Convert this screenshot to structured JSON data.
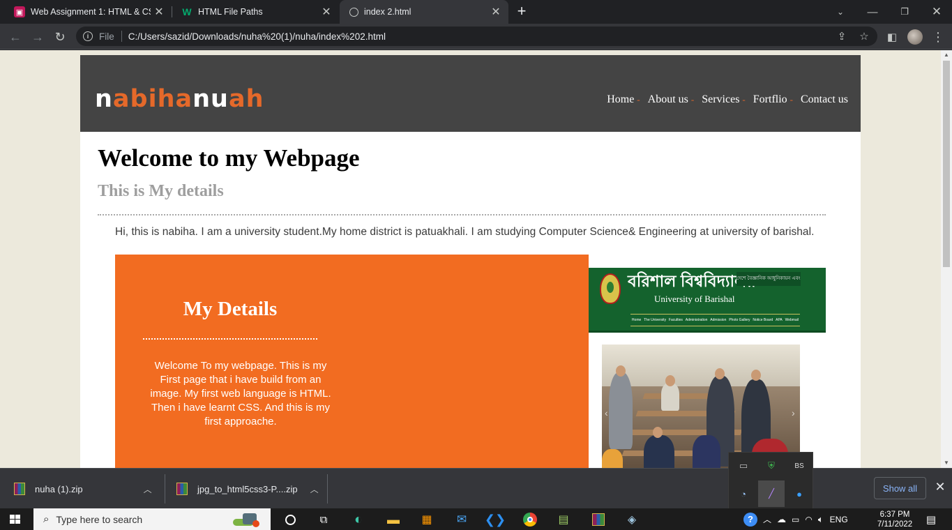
{
  "browser": {
    "tabs": [
      {
        "title": "Web Assignment 1: HTML & CSS",
        "active": false,
        "favicon": "google-classroom-icon"
      },
      {
        "title": "HTML File Paths",
        "active": false,
        "favicon": "w3schools-icon"
      },
      {
        "title": "index 2.html",
        "active": true,
        "favicon": "globe-icon"
      }
    ],
    "omnibox": {
      "scheme_label": "File",
      "url": "C:/Users/sazid/Downloads/nuha%20(1)/nuha/index%202.html"
    }
  },
  "site": {
    "logo": [
      {
        "text": "n",
        "style": "white"
      },
      {
        "text": "abiha",
        "style": "orange"
      },
      {
        "text": "nu",
        "style": "white"
      },
      {
        "text": "ah",
        "style": "orange"
      }
    ],
    "nav": [
      "Home",
      "About us",
      "Services",
      "Fortflio",
      "Contact us"
    ],
    "nav_separator": "-",
    "heading": "Welcome to my Webpage",
    "subheading": "This is My details",
    "intro": "Hi, this is nabiha. I am a university student.My home district is patuakhali. I am studying Computer Science& Engineering at university of barishal.",
    "details": {
      "title": "My Details",
      "text": "Welcome To my webpage. This is my First page that i have build from an image. My first web language is HTML. Then i have learnt CSS. And this is my first approache."
    },
    "university_banner": {
      "name_bn": "বরিশাল বিশ্ববিদ্যালয়",
      "name_en": "University of Barishal",
      "tagline": "দেশে বৈজ্ঞানিক আধুনিকায়ন এবং প্রেরণাদীপ্ত",
      "menu": [
        "Home",
        "The University",
        "Faculties",
        "Administration",
        "Admission",
        "Photo Gallery",
        "Notice Board",
        "APA",
        "Webmail"
      ]
    },
    "colors": {
      "header_bg": "#444444",
      "accent_orange": "#f26c21",
      "banner_green": "#14622d"
    }
  },
  "downloads": {
    "items": [
      {
        "name": "nuha (1).zip"
      },
      {
        "name": "jpg_to_html5css3-P....zip"
      }
    ],
    "show_all": "Show all"
  },
  "taskbar": {
    "search_placeholder": "Type here to search",
    "language": "ENG",
    "time": "6:37 PM",
    "date": "7/11/2022"
  }
}
